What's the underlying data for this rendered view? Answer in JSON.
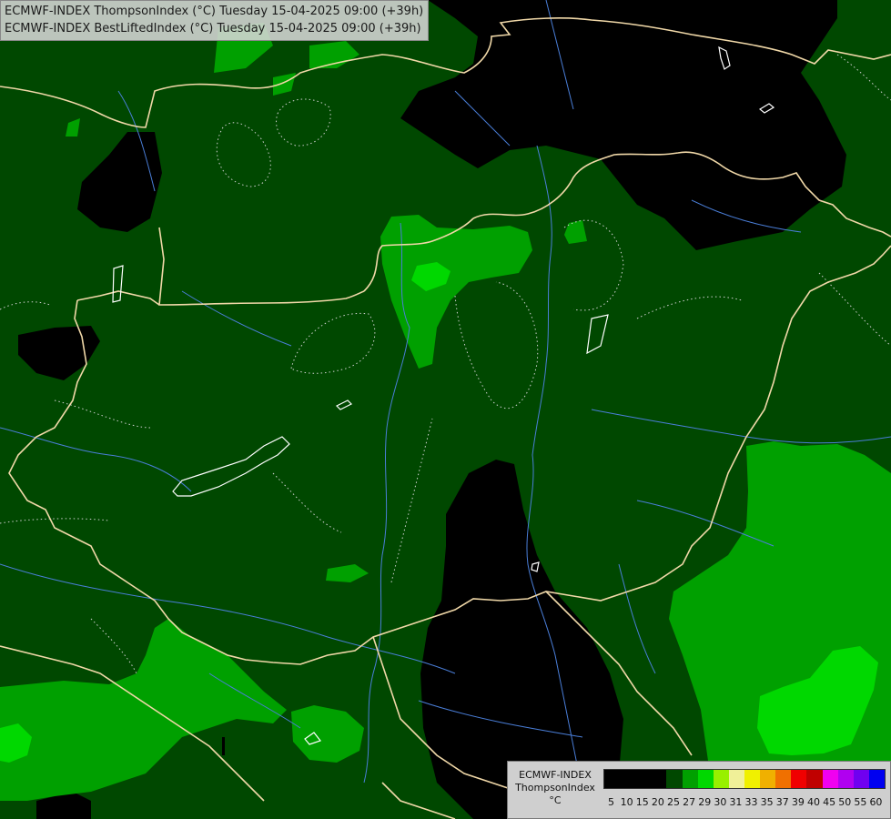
{
  "title_lines": [
    "ECMWF-INDEX ThompsonIndex (°C) Tuesday 15-04-2025 09:00 (+39h)",
    "ECMWF-INDEX BestLiftedIndex (°C) Tuesday 15-04-2025 09:00 (+39h)"
  ],
  "legend": {
    "title_lines": [
      "ECMWF-INDEX",
      "ThompsonIndex",
      "°C"
    ],
    "ticks": [
      "5",
      "10",
      "15",
      "20",
      "25",
      "27",
      "29",
      "30",
      "31",
      "33",
      "35",
      "37",
      "39",
      "40",
      "45",
      "50",
      "55",
      "60"
    ],
    "colors": [
      "#000000",
      "#000000",
      "#000000",
      "#000000",
      "#004800",
      "#00a000",
      "#00d800",
      "#98f000",
      "#f0f098",
      "#f0f000",
      "#f0b000",
      "#f07000",
      "#f00000",
      "#c00000",
      "#f000f0",
      "#b000f0",
      "#7000f0",
      "#0000f0"
    ]
  },
  "palette": {
    "base": "#004800",
    "dark": "#000000",
    "mid_green": "#00a000",
    "bright_green": "#00d800",
    "border": "#f0d8a8",
    "rivers": "#4a7ed8",
    "isolines": "#cfcfcf"
  }
}
